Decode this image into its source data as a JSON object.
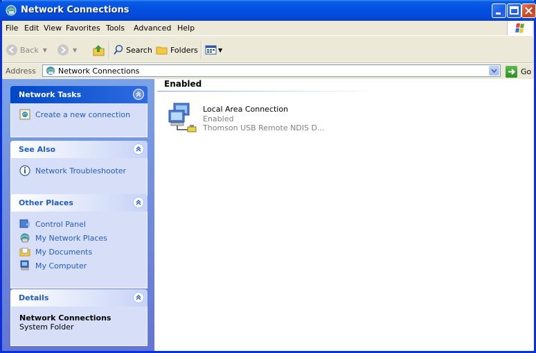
{
  "window": {
    "title": "Network Connections",
    "icon": "network-connections-icon"
  },
  "menu": {
    "file": "File",
    "edit": "Edit",
    "view": "View",
    "favorites": "Favorites",
    "tools": "Tools",
    "advanced": "Advanced",
    "help": "Help"
  },
  "toolbar": {
    "back": "Back",
    "search": "Search",
    "folders": "Folders"
  },
  "address": {
    "label": "Address",
    "value": "Network Connections",
    "go": "Go"
  },
  "sidebar": {
    "network_tasks": {
      "title": "Network Tasks",
      "items": [
        "Create a new connection"
      ]
    },
    "see_also": {
      "title": "See Also",
      "items": [
        "Network Troubleshooter"
      ]
    },
    "other_places": {
      "title": "Other Places",
      "items": [
        "Control Panel",
        "My Network Places",
        "My Documents",
        "My Computer"
      ]
    },
    "details": {
      "title": "Details",
      "name": "Network Connections",
      "type": "System Folder"
    }
  },
  "main": {
    "group_header": "Enabled",
    "items": [
      {
        "name": "Local Area Connection",
        "status": "Enabled",
        "device": "Thomson USB Remote NDIS D..."
      }
    ]
  },
  "colors": {
    "title_bar": "#0551E0",
    "sidebar_gradient_top": "#7BA2E7",
    "sidebar_gradient_bottom": "#6375D6",
    "link": "#215DC6"
  }
}
